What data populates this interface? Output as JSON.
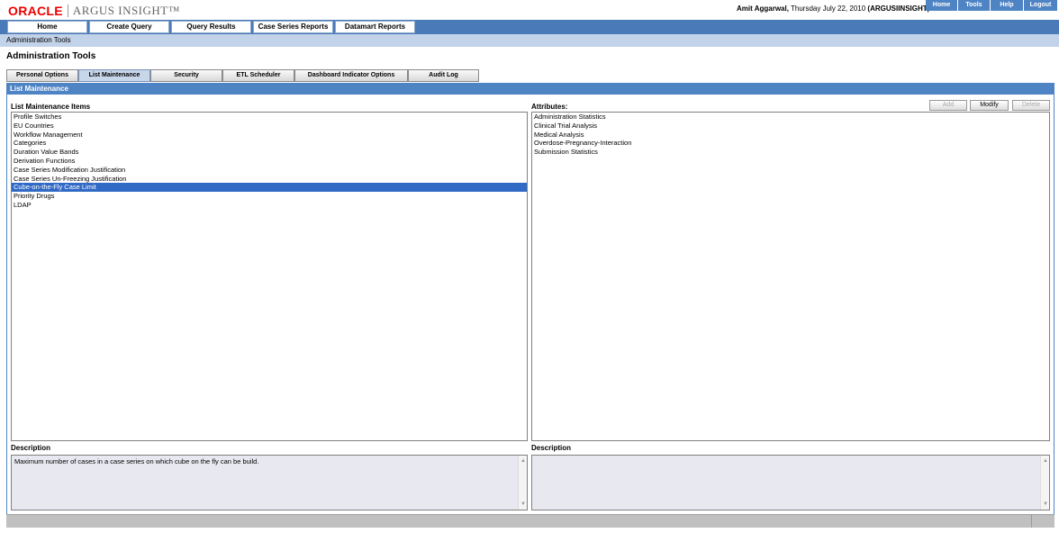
{
  "header": {
    "logo_brand": "ORACLE",
    "logo_product": "ARGUS INSIGHT™",
    "user_name": "Amit Aggarwal,",
    "date_text": "Thursday July 22, 2010",
    "instance": "(ARGUSIINSIGHT)",
    "global_links": [
      "Home",
      "Tools",
      "Help",
      "Logout"
    ]
  },
  "main_nav": [
    "Home",
    "Create Query",
    "Query Results",
    "Case Series Reports",
    "Datamart Reports"
  ],
  "breadcrumb": "Administration Tools",
  "page_title": "Administration Tools",
  "tabs": [
    {
      "label": "Personal Options",
      "active": false
    },
    {
      "label": "List Maintenance",
      "active": true
    },
    {
      "label": "Security",
      "active": false
    },
    {
      "label": "ETL Scheduler",
      "active": false
    },
    {
      "label": "Dashboard Indicator Options",
      "active": false
    },
    {
      "label": "Audit Log",
      "active": false
    }
  ],
  "section_title": "List Maintenance",
  "left_panel": {
    "label": "List Maintenance Items",
    "items": [
      "Profile Switches",
      "EU Countries",
      "Workflow Management",
      "Categories",
      "Duration Value Bands",
      "Derivation Functions",
      "Case Series Modification Justification",
      "Case Series Un-Freezing Justification",
      "Cube-on-the-Fly Case Limit",
      "Priority Drugs",
      "LDAP"
    ],
    "selected_index": 8,
    "description_label": "Description",
    "description_text": "Maximum number of cases in a case series on which cube on the fly can be build."
  },
  "right_panel": {
    "label": "Attributes:",
    "items": [
      "Administration Statistics",
      "Clinical Trial Analysis",
      "Medical Analysis",
      "Overdose-Pregnancy-Interaction",
      "Submission Statistics"
    ],
    "buttons": {
      "add": "Add",
      "modify": "Modify",
      "delete": "Delete"
    },
    "description_label": "Description",
    "description_text": ""
  },
  "colors": {
    "nav_blue": "#4a7ab8",
    "section_blue": "#4f84c4",
    "selection_blue": "#316ac5",
    "breadcrumb_bg": "#c2d2e8",
    "oracle_red": "#ee0000"
  }
}
